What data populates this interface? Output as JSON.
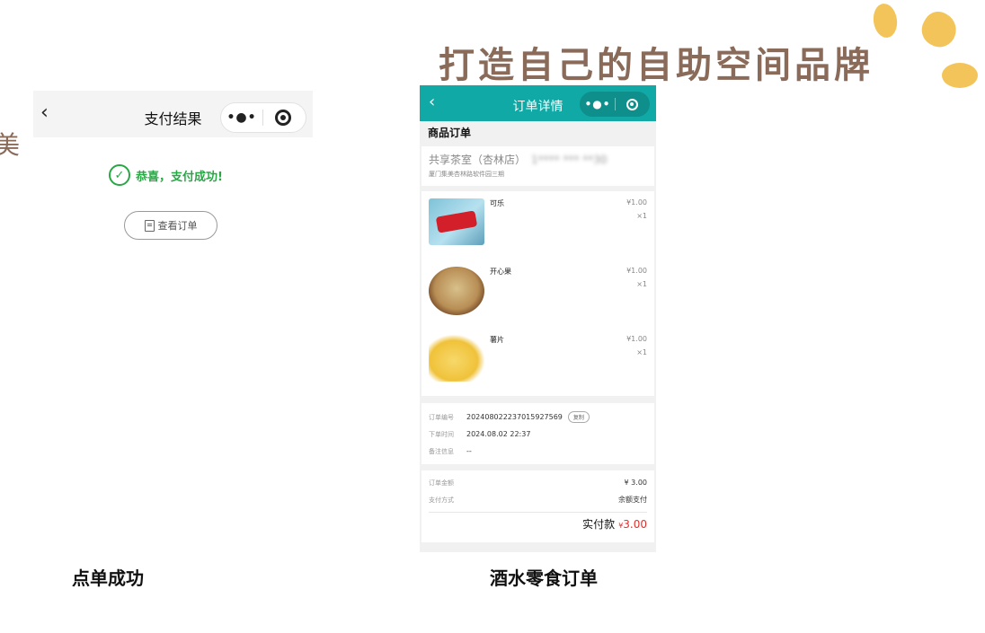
{
  "headline": "打造自己的自助空间品牌",
  "edge_glyph": "美",
  "left_screen": {
    "nav": {
      "back_icon": "‹",
      "title": "支付结果",
      "capsule_dots": "•●•"
    },
    "success_text": "恭喜，支付成功!",
    "view_order_label": "查看订单",
    "caption": "点单成功"
  },
  "right_screen": {
    "nav": {
      "back_icon": "‹",
      "title": "订单详情",
      "capsule_dots": "•●•"
    },
    "section_title": "商品订单",
    "store": {
      "name": "共享茶室（杏林店）",
      "phone": "1**** *** **30",
      "address": "厦门集美杏林路软件园三期"
    },
    "items": [
      {
        "name": "可乐",
        "price": "¥1.00",
        "qty": "×1",
        "image": "cola"
      },
      {
        "name": "开心果",
        "price": "¥1.00",
        "qty": "×1",
        "image": "pistachio"
      },
      {
        "name": "薯片",
        "price": "¥1.00",
        "qty": "×1",
        "image": "chips"
      }
    ],
    "order_info": {
      "number_label": "订单编号",
      "number": "202408022237015927569",
      "copy_label": "复制",
      "time_label": "下单时间",
      "time": "2024.08.02 22:37",
      "note_label": "备注信息",
      "note": "--"
    },
    "payment": {
      "amount_label": "订单金额",
      "amount": "¥ 3.00",
      "method_label": "支付方式",
      "method": "余额支付",
      "total_label": "实付款",
      "total_currency": "¥",
      "total_value": "3.00"
    },
    "caption": "酒水零食订单"
  },
  "colors": {
    "brand_teal": "#10a9a6",
    "success_green": "#28a745",
    "price_red": "#e0302e",
    "accent_yellow": "#f3c45a"
  }
}
